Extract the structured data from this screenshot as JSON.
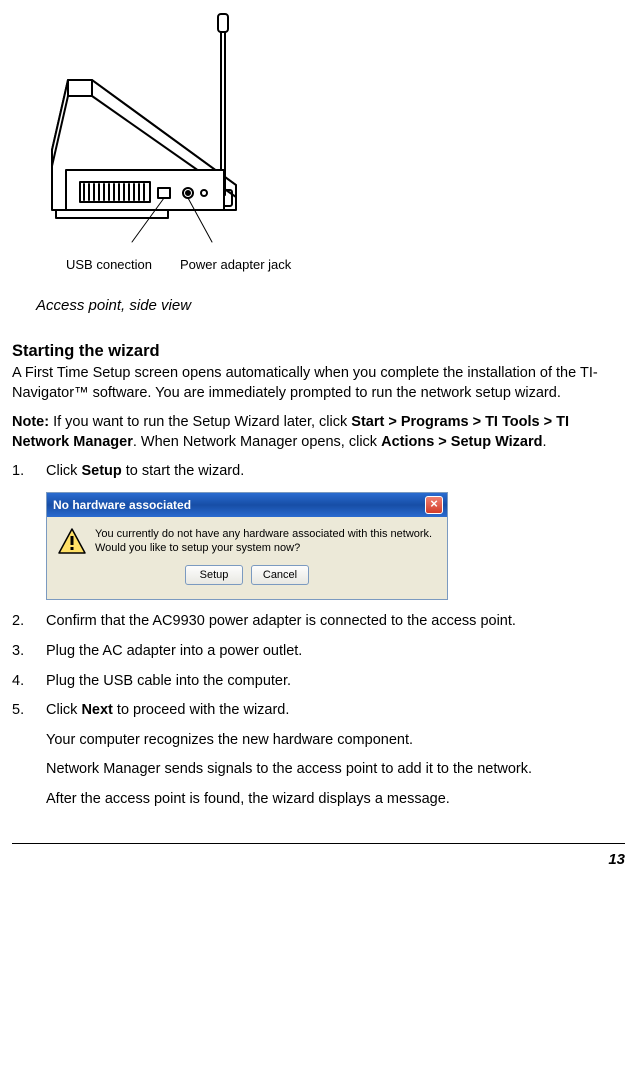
{
  "figure": {
    "label_usb": "USB conection",
    "label_power": "Power adapter jack",
    "caption": "Access point, side view"
  },
  "heading": "Starting the wizard",
  "intro": "A First Time Setup screen opens automatically when you complete the installation of the TI-Navigator™ software. You are immediately prompted to run the network setup wizard.",
  "note": {
    "label": "Note:",
    "text_before": " If you want to run the Setup Wizard later, click ",
    "path": "Start > Programs > TI Tools > TI Network Manager",
    "text_mid": ". When Network Manager opens, click ",
    "path2": "Actions > Setup Wizard",
    "text_after": "."
  },
  "steps": {
    "s1_before": "Click ",
    "s1_bold": "Setup",
    "s1_after": " to start the wizard.",
    "s2": "Confirm that the AC9930 power adapter is connected to the access point.",
    "s3": "Plug the AC adapter into a power outlet.",
    "s4": "Plug the USB cable into the computer.",
    "s5_before": "Click ",
    "s5_bold": "Next",
    "s5_after": " to proceed with the wizard.",
    "s5_p2": "Your computer recognizes the new hardware component.",
    "s5_p3": "Network Manager sends signals to the access point to add it to the network.",
    "s5_p4": "After the access point is found, the wizard displays a message."
  },
  "dialog": {
    "title": "No hardware associated",
    "line1": "You currently do not have any hardware associated with this network.",
    "line2": "Would you like to setup your system now?",
    "btn_setup": "Setup",
    "btn_cancel": "Cancel"
  },
  "page": "13"
}
